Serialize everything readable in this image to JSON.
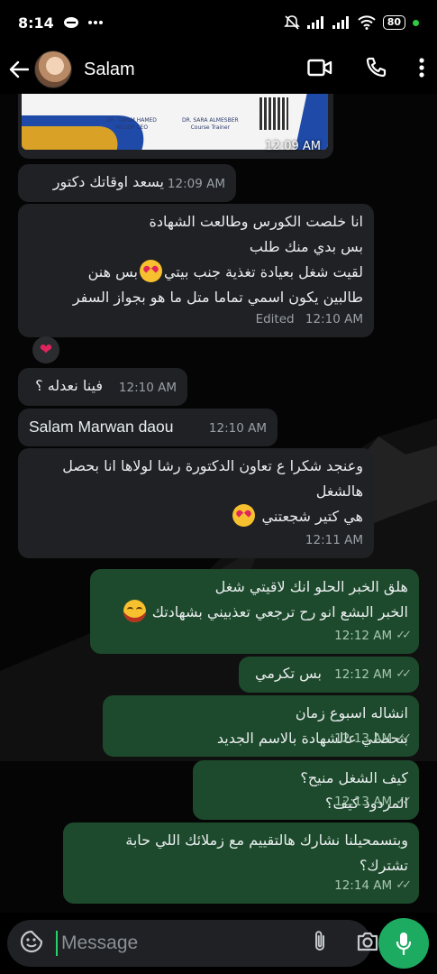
{
  "status_bar": {
    "time": "8:14",
    "battery": "80"
  },
  "header": {
    "contact_name": "Salam"
  },
  "image_card": {
    "sig1_name": "DR. TAMIM HAMED",
    "sig1_role": "MEDUP CEO",
    "sig2_name": "DR. SARA ALMESBER",
    "sig2_role": "Course Trainer",
    "time": "12:09 AM"
  },
  "messages": [
    {
      "dir": "in",
      "lines": [
        "يسعد اوقاتك دكتور"
      ],
      "time": "12:09 AM"
    },
    {
      "dir": "in",
      "lines": [
        "انا خلصت الكورس وطالعت الشهادة",
        "بس بدي منك طلب",
        "لقيت شغل بعيادة تغذية جنب بيتي",
        "طالبين يكون اسمي تماما متل ما هو بجواز السفر"
      ],
      "line3_tail": "بس هنن",
      "edited": "Edited",
      "time": "12:10 AM"
    },
    {
      "dir": "in",
      "lines": [
        "فينا نعدله ؟"
      ],
      "time": "12:10 AM"
    },
    {
      "dir": "in",
      "lines": [
        "Salam Marwan daou"
      ],
      "time": "12:10 AM"
    },
    {
      "dir": "in",
      "lines": [
        "وعنجد شكرا ع تعاون الدكتورة رشا لولاها انا بحصل",
        "هالشغل",
        "هي كتير شجعتني"
      ],
      "time": "12:11 AM"
    },
    {
      "dir": "out",
      "lines": [
        "هلق الخبر الحلو انك لاقيتي شغل",
        "الخبر البشع انو رح ترجعي تعذبيني بشهادتك"
      ],
      "time": "12:12 AM"
    },
    {
      "dir": "out",
      "lines": [
        "بس تكرمي"
      ],
      "time": "12:12 AM"
    },
    {
      "dir": "out",
      "lines": [
        "انشاله اسبوع زمان",
        "بتحصلي عالشهادة بالاسم الجديد"
      ],
      "time": "12:13 AM"
    },
    {
      "dir": "out",
      "lines": [
        "كيف الشغل منيح؟",
        "المردود كيف؟"
      ],
      "time": "12:13 AM"
    },
    {
      "dir": "out",
      "lines": [
        "وبتسمحيلنا نشارك هالتقييم مع زملائك اللي حابة",
        "تشترك؟"
      ],
      "time": "12:14 AM"
    }
  ],
  "reaction": "heart",
  "input": {
    "placeholder": "Message"
  },
  "colors": {
    "incoming": "#1f2124",
    "outgoing": "#1d4a2c",
    "accent": "#1daa61"
  }
}
